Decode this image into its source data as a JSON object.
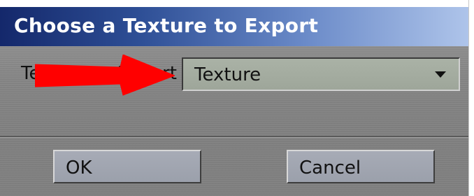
{
  "window": {
    "title": "Choose a Texture to Export"
  },
  "form": {
    "texture_label": "Texture to Export",
    "texture_select": {
      "selected": "Texture"
    }
  },
  "buttons": {
    "ok_label": "OK",
    "cancel_label": "Cancel"
  },
  "annotation": {
    "icon": "red-arrow-icon",
    "color": "#ff0000"
  },
  "colors": {
    "title_bar_start": "#14286b",
    "title_bar_end": "#aec4ea",
    "panel": "#858585",
    "select_bg": "#a4ac9f",
    "button_bg": "#a1a5b0"
  }
}
